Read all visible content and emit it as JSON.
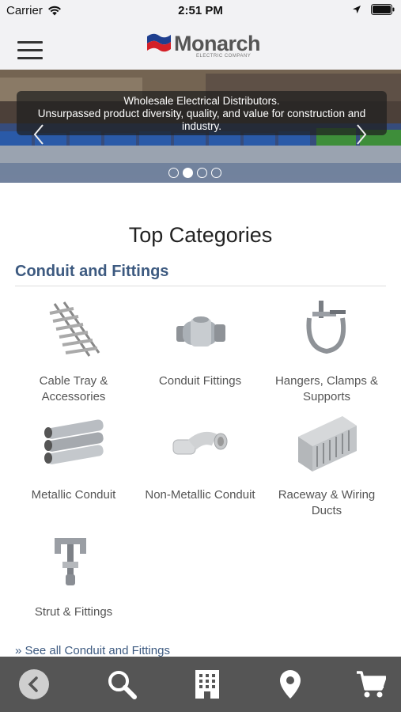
{
  "status_bar": {
    "carrier": "Carrier",
    "time": "2:51 PM"
  },
  "header": {
    "logo_name": "Monarch",
    "logo_tagline": "ELECTRIC COMPANY"
  },
  "hero": {
    "caption_line1": "Wholesale Electrical Distributors.",
    "caption_line2": "Unsurpassed product diversity, quality, and value for construction and industry.",
    "slide_count": 4,
    "active_slide": 2
  },
  "main": {
    "title": "Top Categories",
    "section_heading": "Conduit and Fittings",
    "categories": [
      {
        "label": "Cable Tray & Accessories",
        "icon": "cable-tray-icon"
      },
      {
        "label": "Conduit Fittings",
        "icon": "conduit-fitting-icon"
      },
      {
        "label": "Hangers, Clamps & Supports",
        "icon": "hanger-clamp-icon"
      },
      {
        "label": "Metallic Conduit",
        "icon": "metallic-conduit-icon"
      },
      {
        "label": "Non-Metallic Conduit",
        "icon": "non-metallic-conduit-icon"
      },
      {
        "label": "Raceway & Wiring Ducts",
        "icon": "raceway-duct-icon"
      },
      {
        "label": "Strut & Fittings",
        "icon": "strut-fitting-icon"
      }
    ],
    "see_all": "» See all Conduit and Fittings"
  },
  "bottom_nav": {
    "items": [
      "back-icon",
      "search-icon",
      "building-icon",
      "location-pin-icon",
      "cart-icon"
    ]
  },
  "colors": {
    "accent": "#3d5a80",
    "nav_bg": "#555555",
    "header_bg": "#f2f2f4"
  }
}
